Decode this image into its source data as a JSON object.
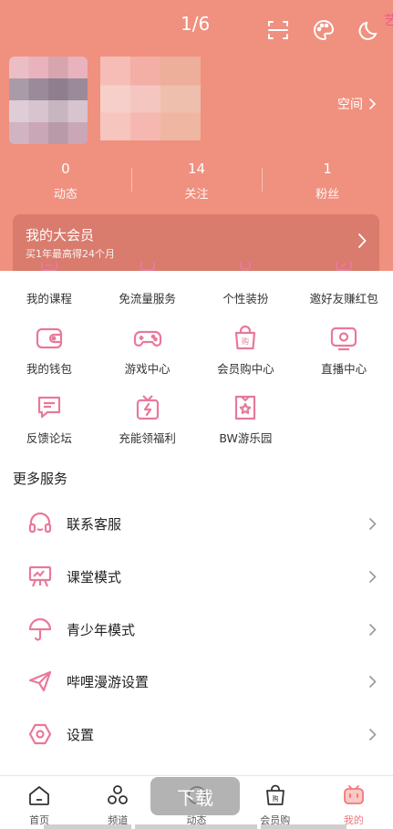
{
  "header": {
    "counter": "1/6",
    "corner_mark": "艺",
    "space_link": "空间",
    "stats": [
      {
        "value": "0",
        "label": "动态"
      },
      {
        "value": "14",
        "label": "关注"
      },
      {
        "value": "1",
        "label": "粉丝"
      }
    ],
    "vip": {
      "title": "我的大会员",
      "subtitle": "买1年最高得24个月"
    }
  },
  "grid_rows": [
    [
      {
        "label": "我的课程",
        "icon": "course-icon"
      },
      {
        "label": "免流量服务",
        "icon": "free-data-icon"
      },
      {
        "label": "个性装扮",
        "icon": "dress-up-icon"
      },
      {
        "label": "邀好友赚红包",
        "icon": "invite-icon"
      }
    ],
    [
      {
        "label": "我的钱包",
        "icon": "wallet-icon"
      },
      {
        "label": "游戏中心",
        "icon": "gamepad-icon"
      },
      {
        "label": "会员购中心",
        "icon": "shopping-bag-icon"
      },
      {
        "label": "直播中心",
        "icon": "live-tv-icon"
      }
    ],
    [
      {
        "label": "反馈论坛",
        "icon": "feedback-icon"
      },
      {
        "label": "充能领福利",
        "icon": "charge-gift-icon"
      },
      {
        "label": "BW游乐园",
        "icon": "bw-park-icon"
      }
    ]
  ],
  "more_services": {
    "title": "更多服务",
    "items": [
      {
        "label": "联系客服",
        "icon": "headset-icon"
      },
      {
        "label": "课堂模式",
        "icon": "classroom-icon"
      },
      {
        "label": "青少年模式",
        "icon": "umbrella-icon"
      },
      {
        "label": "哔哩漫游设置",
        "icon": "paper-plane-icon"
      },
      {
        "label": "设置",
        "icon": "settings-icon"
      }
    ]
  },
  "bottom_nav": {
    "items": [
      {
        "label": "首页",
        "icon": "home-icon"
      },
      {
        "label": "频道",
        "icon": "channel-icon"
      },
      {
        "label": "动态",
        "icon": "dynamic-icon"
      },
      {
        "label": "会员购",
        "icon": "shopping-bag-icon"
      },
      {
        "label": "我的",
        "icon": "tv-face-icon"
      }
    ],
    "active": "我的"
  },
  "download_overlay": "下载",
  "colors": {
    "header": "#f0907f",
    "vip": "#d97b6d",
    "accent": "#f0787e",
    "icon_pink": "#e8799a"
  }
}
